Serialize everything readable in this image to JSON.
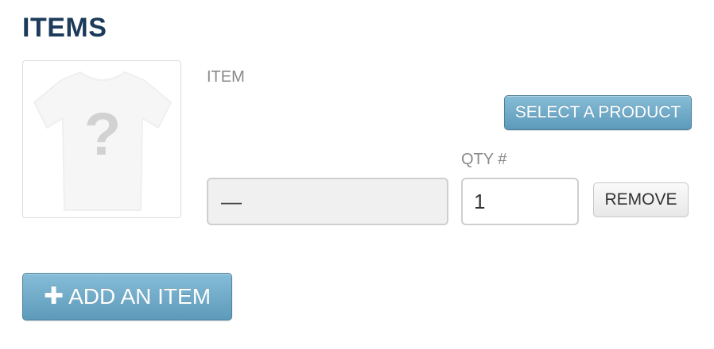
{
  "section": {
    "title": "ITEMS"
  },
  "item_row": {
    "image_icon": "tshirt-placeholder-icon",
    "item_label": "ITEM",
    "select_product_label": "SELECT A PRODUCT",
    "item_value": "—",
    "qty_label": "QTY #",
    "qty_value": "1",
    "remove_label": "REMOVE"
  },
  "add_item": {
    "icon": "plus-icon",
    "label": "ADD AN ITEM"
  },
  "colors": {
    "title": "#1c3b5a",
    "button_blue": "#6aa8c7",
    "label_gray": "#8a8a8a"
  }
}
